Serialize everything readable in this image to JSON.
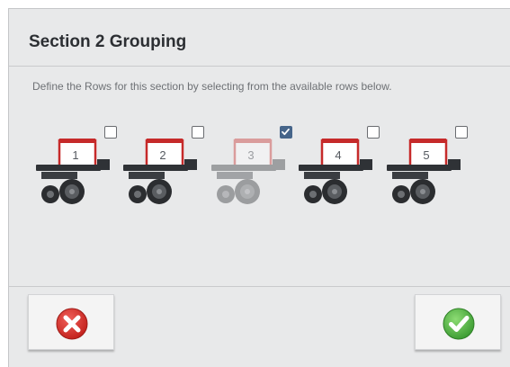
{
  "dialog": {
    "title": "Section 2 Grouping",
    "instructions": "Define the Rows for this section by selecting from the available rows below."
  },
  "rows": [
    {
      "label": "1",
      "checked": false,
      "disabled": false
    },
    {
      "label": "2",
      "checked": false,
      "disabled": false
    },
    {
      "label": "3",
      "checked": true,
      "disabled": true
    },
    {
      "label": "4",
      "checked": false,
      "disabled": false
    },
    {
      "label": "5",
      "checked": false,
      "disabled": false
    }
  ],
  "footer": {
    "cancel_icon": "cancel-x-icon",
    "confirm_icon": "confirm-check-icon"
  },
  "colors": {
    "cancel_red": "#d9322c",
    "confirm_green": "#4fb542",
    "checkbox_checked": "#46658a"
  }
}
